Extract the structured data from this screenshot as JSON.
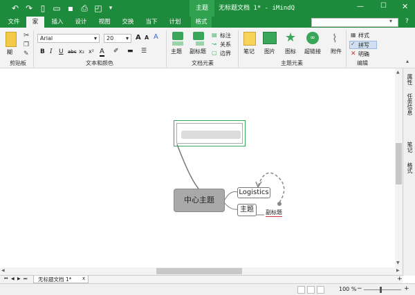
{
  "window": {
    "title": "无标题文档 1* - iMindQ",
    "context_tab": "主题",
    "minimize": "—",
    "maximize": "☐",
    "close": "✕"
  },
  "quick_access": [
    "undo-icon",
    "redo-icon",
    "new-file-icon",
    "open-folder-icon",
    "save-icon",
    "print-icon",
    "preview-icon",
    "dropdown-icon"
  ],
  "tabs": [
    {
      "label": "文件"
    },
    {
      "label": "家"
    },
    {
      "label": "插入"
    },
    {
      "label": "设计"
    },
    {
      "label": "视图"
    },
    {
      "label": "交换"
    },
    {
      "label": "当下"
    },
    {
      "label": "计划"
    },
    {
      "label": "格式"
    }
  ],
  "ribbon": {
    "clipboard": {
      "group": "剪贴板",
      "paste": "糊"
    },
    "font": {
      "group": "文本和颜色",
      "family": "Arial",
      "size": "20",
      "bold": "B",
      "italic": "I",
      "underline": "U",
      "strike": "abc",
      "sub": "x₂",
      "sup": "x²",
      "fontcolor": "A",
      "grow": "A",
      "shrink": "A"
    },
    "doc": {
      "group": "文档元素",
      "topic": "主题",
      "subtopic": "副标题",
      "label": "标注",
      "relation": "关系",
      "boundary": "边界"
    },
    "topic_elems": {
      "group": "主题元素",
      "note": "笔记",
      "picture": "图片",
      "icon": "图标",
      "hyperlink": "超链接",
      "attachment": "附件"
    },
    "edit": {
      "group": "编辑",
      "style": "样式",
      "spell": "拼写",
      "clear": "明确"
    }
  },
  "side_panel": [
    "属性",
    "任务信息",
    "笔记",
    "格式"
  ],
  "map": {
    "central": "中心主题",
    "topic_logistics": "Logistics",
    "topic_main": "主题",
    "subtitle": "副标题"
  },
  "sheet": {
    "tab_label": "无标题文档 1*",
    "close": "x"
  },
  "status": {
    "zoom": "100 %",
    "minus": "−",
    "plus": "+"
  },
  "colors": {
    "brand": "#1e8b3c",
    "central_fill": "#a9a9a9"
  }
}
